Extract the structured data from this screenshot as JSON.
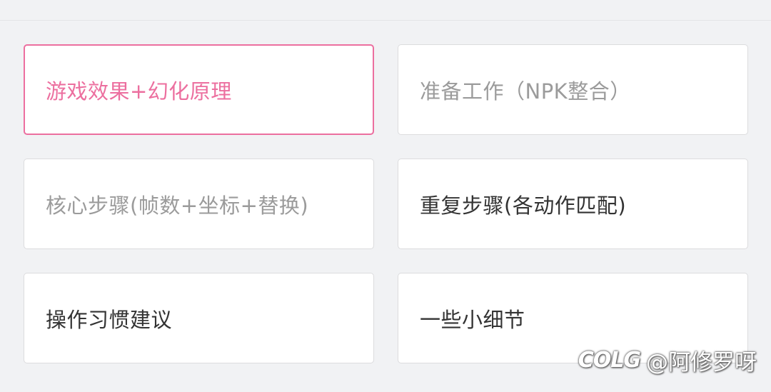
{
  "colors": {
    "selected": "#ec6f9f",
    "dimmed": "#9b9b9b",
    "normal": "#333333",
    "background": "#f1f2f4"
  },
  "options": [
    {
      "label": "游戏效果+幻化原理",
      "state": "selected"
    },
    {
      "label": "准备工作（NPK整合）",
      "state": "dimmed"
    },
    {
      "label": "核心步骤(帧数+坐标+替换)",
      "state": "dimmed"
    },
    {
      "label": "重复步骤(各动作匹配)",
      "state": "normal"
    },
    {
      "label": "操作习惯建议",
      "state": "normal"
    },
    {
      "label": "一些小细节",
      "state": "normal"
    }
  ],
  "watermark": {
    "logo": "COLG",
    "text": "@阿修罗呀"
  }
}
